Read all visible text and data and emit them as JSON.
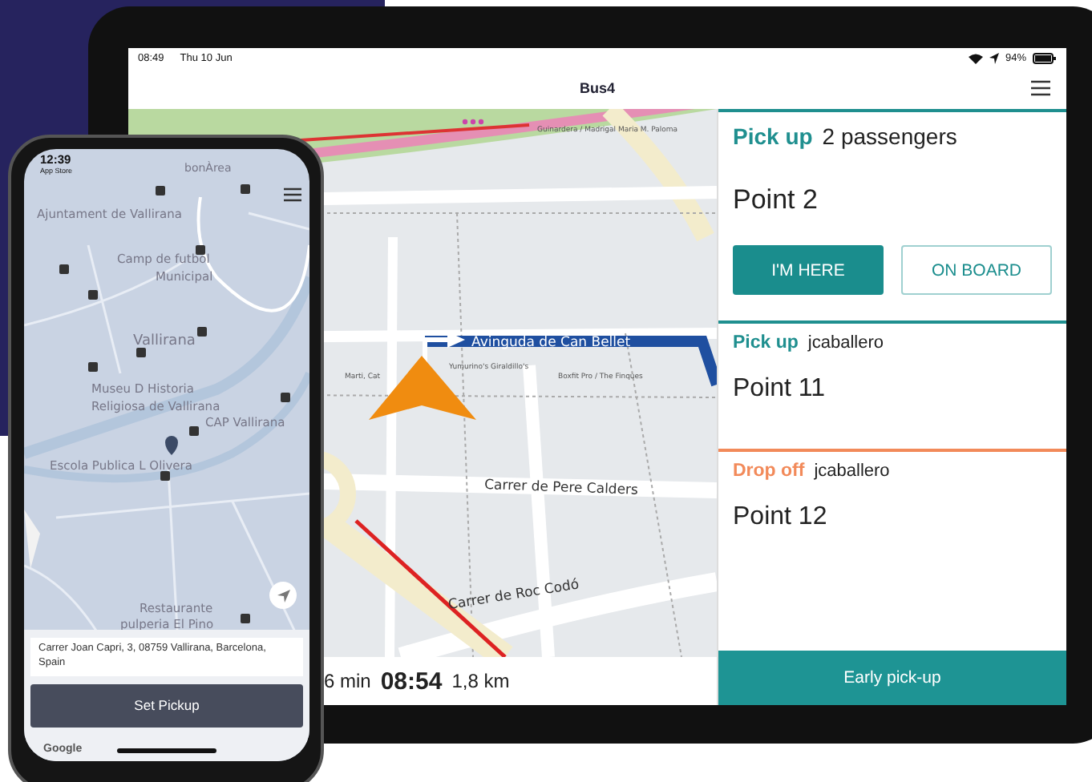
{
  "tablet": {
    "status_bar": {
      "time": "08:49",
      "date": "Thu 10 Jun",
      "battery": "94%"
    },
    "title": "Bus4",
    "map": {
      "labels": [
        "Avinguda de Can Bellet",
        "Carrer de Pere Calders",
        "Carrer de Roc Codó",
        "Guinardera / Madrigal Maria M. Paloma",
        "Marti, Cat",
        "Yumurino's Giraldillo's",
        "Boxfit Pro / The Finques"
      ]
    },
    "trip": {
      "duration": "6 min",
      "arrival": "08:54",
      "distance": "1,8 km"
    },
    "stops": [
      {
        "kind": "pickup",
        "label": "Pick up",
        "who": "2 passengers",
        "point": "Point 2",
        "buttons": [
          {
            "label": "I'M HERE",
            "primary": true
          },
          {
            "label": "ON BOARD",
            "primary": false
          }
        ]
      },
      {
        "kind": "pickup",
        "label": "Pick up",
        "who": "jcaballero",
        "point": "Point 11"
      },
      {
        "kind": "dropoff",
        "label": "Drop off",
        "who": "jcaballero",
        "point": "Point 12"
      }
    ],
    "footer_button": "Early pick-up"
  },
  "phone": {
    "status_bar": {
      "time": "12:39",
      "back_link": "App Store"
    },
    "map": {
      "labels": [
        "bonÀrea",
        "Ajuntament de Vallirana",
        "Camp de futbol",
        "Municipal",
        "Vallirana",
        "Museu D Historia",
        "Religiosa de Vallirana",
        "CAP Vallirana",
        "Escola Publica L Olivera",
        "Restaurante",
        "pulperia El Pino"
      ]
    },
    "address": "Carrer Joan Capri, 3, 08759 Vallirana, Barcelona, Spain",
    "button": "Set Pickup",
    "map_credit": "Google"
  }
}
